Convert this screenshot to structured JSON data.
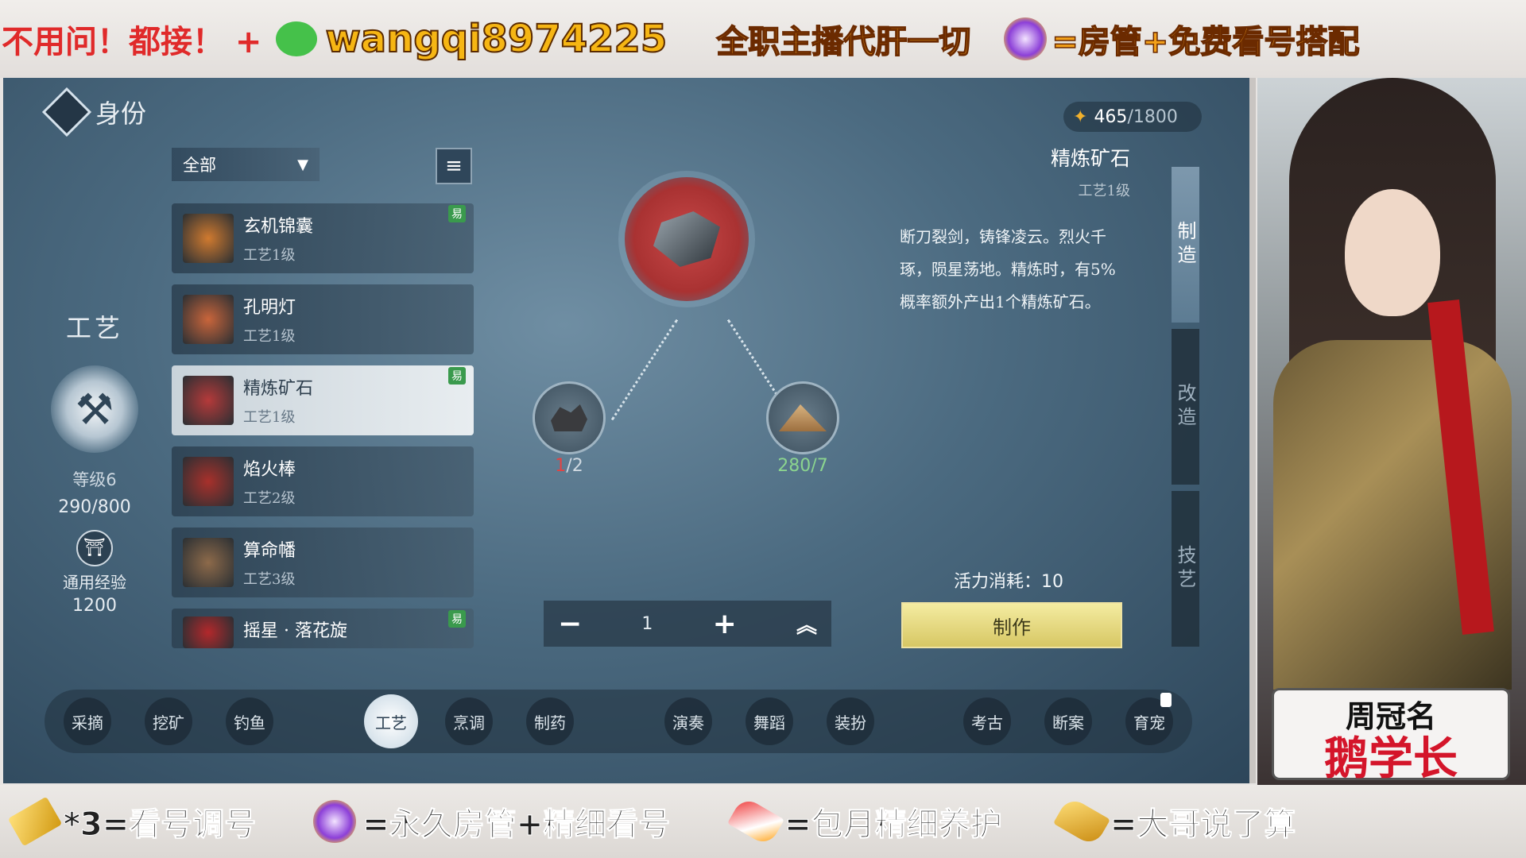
{
  "banner_top": {
    "text1": "不用问！都接！ +",
    "wechat_id": "wangqi8974225",
    "text2": "全职主播代肝一切",
    "text3": "=房管+免费看号搭配"
  },
  "banner_bottom": {
    "item1": "*3=看号调号",
    "item2": "=永久房管+精细看号",
    "item3": "=包月精细养护",
    "item4": "=大哥说了算"
  },
  "game": {
    "page_title": "身份",
    "stamina": {
      "current": "465",
      "max": "/1800"
    },
    "filter": {
      "label": "全部"
    },
    "recipes": [
      {
        "name": "玄机锦囊",
        "level": "工艺1级",
        "easy": "易",
        "color": "#d07a2f"
      },
      {
        "name": "孔明灯",
        "level": "工艺1级",
        "easy": "",
        "color": "#c9653b"
      },
      {
        "name": "精炼矿石",
        "level": "工艺1级",
        "easy": "易",
        "color": "#b53a3a"
      },
      {
        "name": "焰火棒",
        "level": "工艺2级",
        "easy": "",
        "color": "#a8302b"
      },
      {
        "name": "算命幡",
        "level": "工艺3级",
        "easy": "",
        "color": "#8d6a4a"
      },
      {
        "name": "摇星 · 落花旋",
        "level": "",
        "easy": "易",
        "color": "#b3282b"
      }
    ],
    "skill": {
      "category": "工艺",
      "level": "等级6",
      "progress": "290/800",
      "exp_label": "通用经验",
      "exp_value": "1200"
    },
    "materials": [
      {
        "have": "1",
        "need": "/2"
      },
      {
        "have": "280",
        "need": "/7"
      }
    ],
    "quantity": {
      "minus": "−",
      "value": "1",
      "plus": "+",
      "max": "︽"
    },
    "item_info": {
      "name": "精炼矿石",
      "level": "工艺1级",
      "desc": "断刀裂剑，铸锋凌云。烈火千琢，陨星荡地。精炼时，有5%概率额外产出1个精炼矿石。"
    },
    "energy_cost": "活力消耗：10",
    "make_button": "制作",
    "side_tabs": [
      "制造",
      "改造",
      "技艺"
    ],
    "bottom_tabs": [
      "采摘",
      "挖矿",
      "钓鱼",
      "工艺",
      "烹调",
      "制药",
      "演奏",
      "舞蹈",
      "装扮",
      "考古",
      "断案",
      "育宠"
    ],
    "active_bottom_tab": "工艺"
  },
  "streamer": {
    "title_line": "周冠名",
    "name_line": "鹅学长"
  }
}
